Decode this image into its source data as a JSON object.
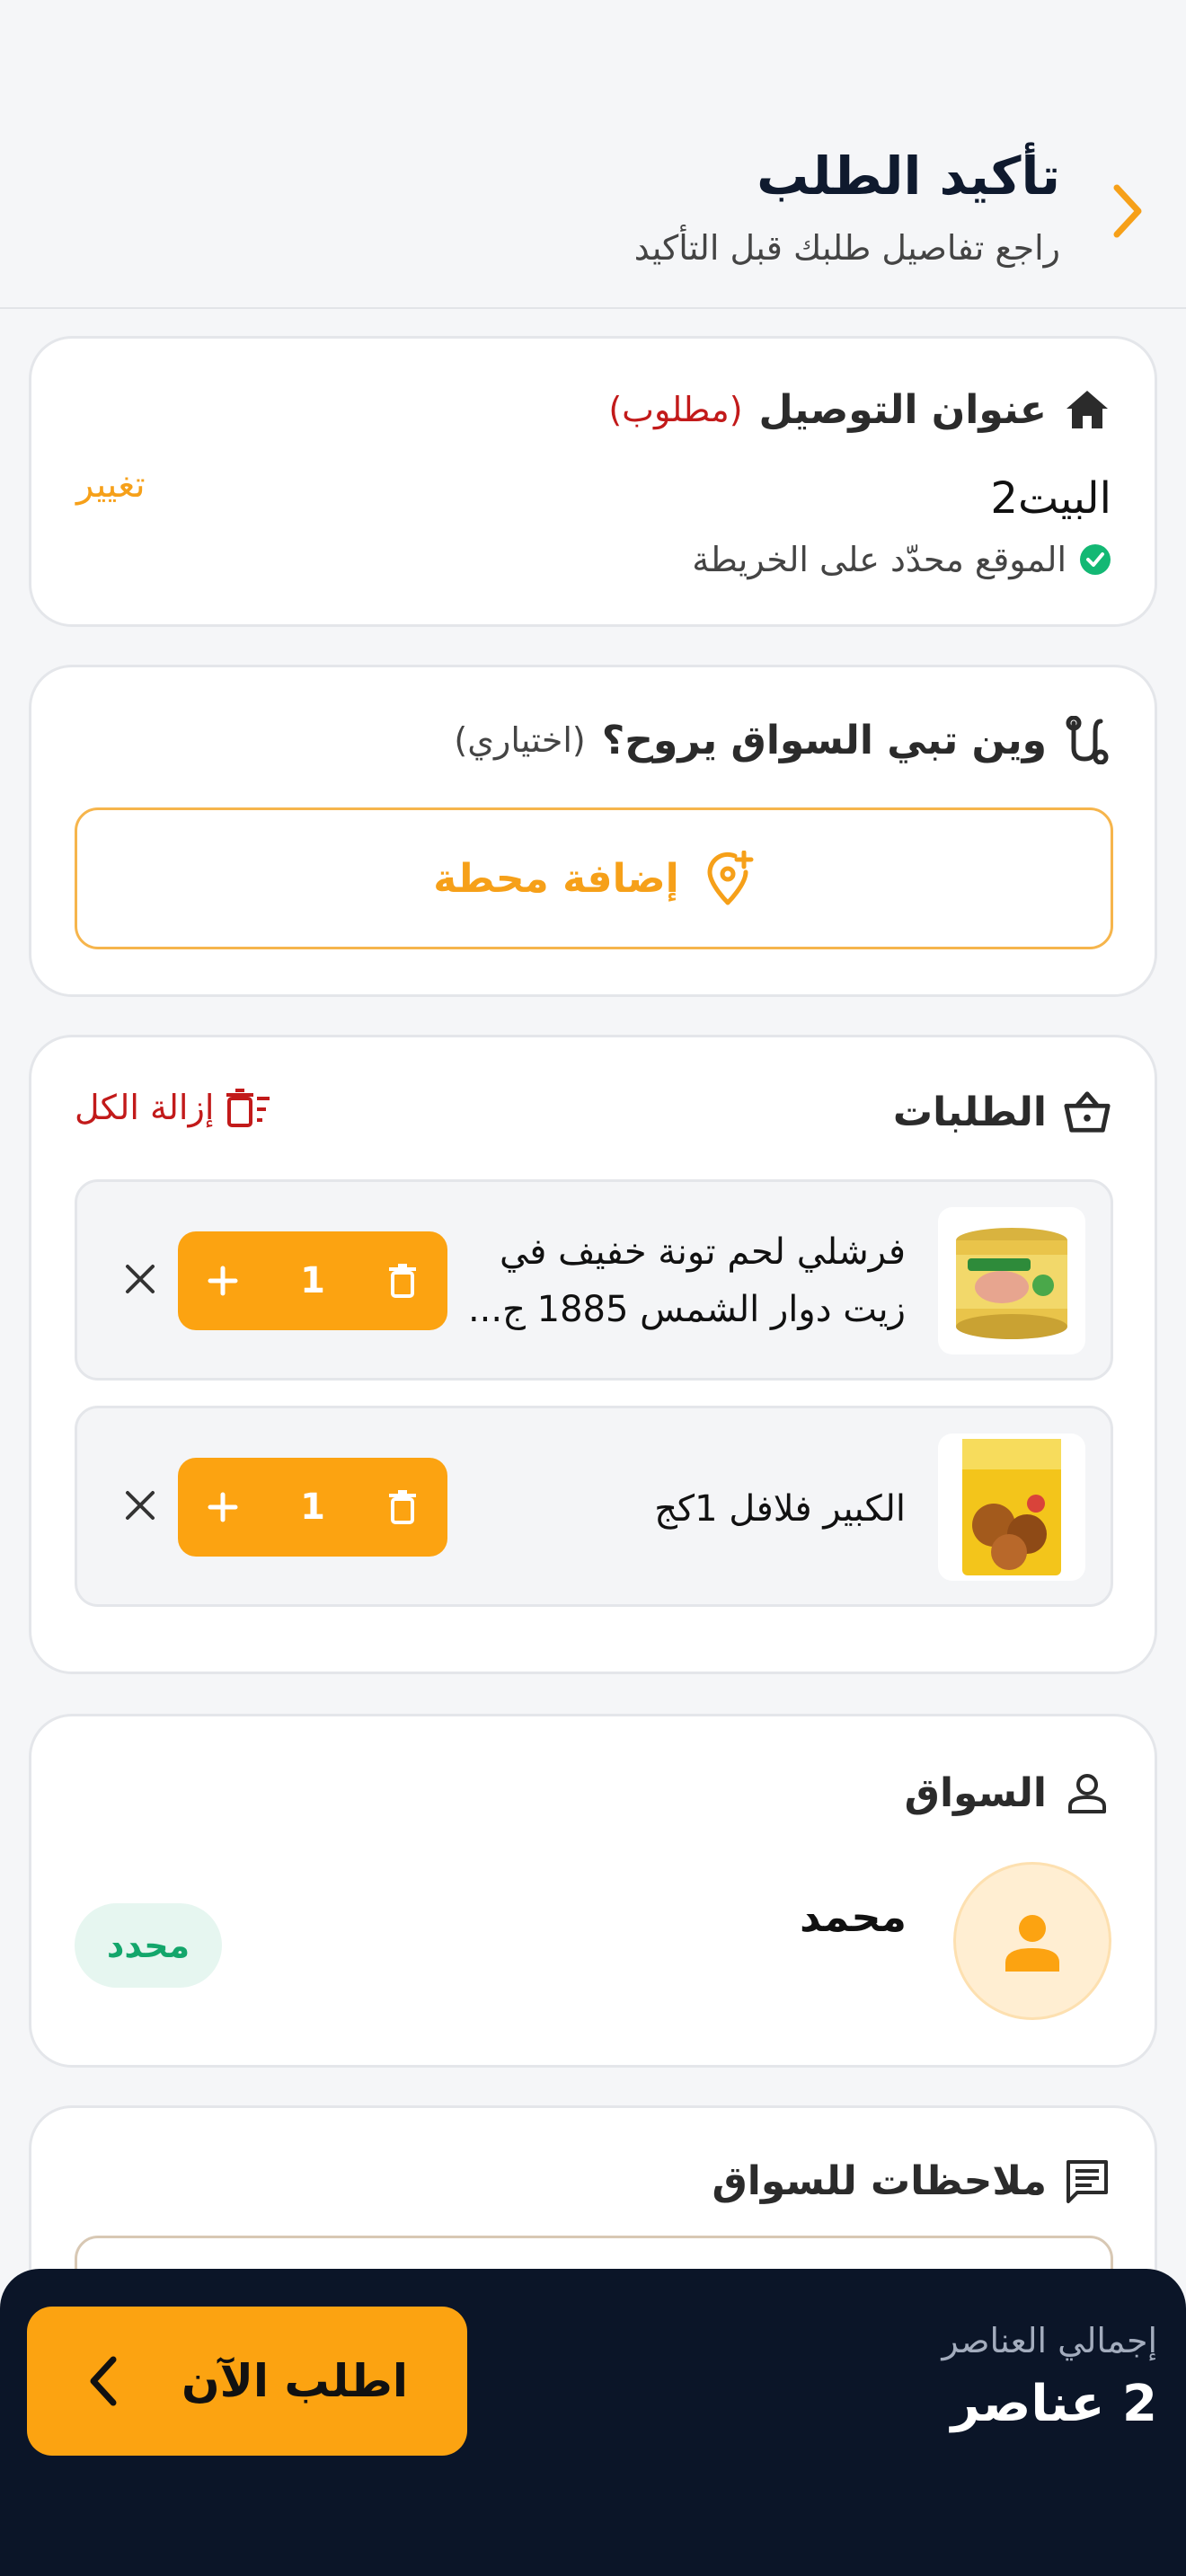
{
  "header": {
    "title": "تأكيد الطلب",
    "subtitle": "راجع تفاصيل طلبك قبل التأكيد",
    "back_icon": "chevron-right-icon"
  },
  "address": {
    "title": "عنوان التوصيل",
    "tag": "(مطلوب)",
    "change_label": "تغيير",
    "name": "البيت2",
    "status": "الموقع محدّد على الخريطة"
  },
  "stops": {
    "title": "وين تبي السواق يروح؟",
    "tag": "(اختياري)",
    "add_label": "إضافة محطة"
  },
  "orders": {
    "title": "الطلبات",
    "remove_all_label": "إزالة الكل",
    "items": [
      {
        "name": "فرشلي لحم تونة خفيف في زيت دوار الشمس 1885 ج...",
        "qty": "1"
      },
      {
        "name": "الكبير فلافل 1كج",
        "qty": "1"
      }
    ]
  },
  "driver": {
    "title": "السواق",
    "name": "محمد",
    "badge": "محدد"
  },
  "notes": {
    "title": "ملاحظات للسواق"
  },
  "footer": {
    "total_label": "إجمالي العناصر",
    "total_value": "2 عناصر",
    "order_label": "اطلب الآن"
  },
  "colors": {
    "accent": "#fca311",
    "dark": "#0b1528",
    "success": "#13a66b",
    "danger": "#c21a1a"
  }
}
